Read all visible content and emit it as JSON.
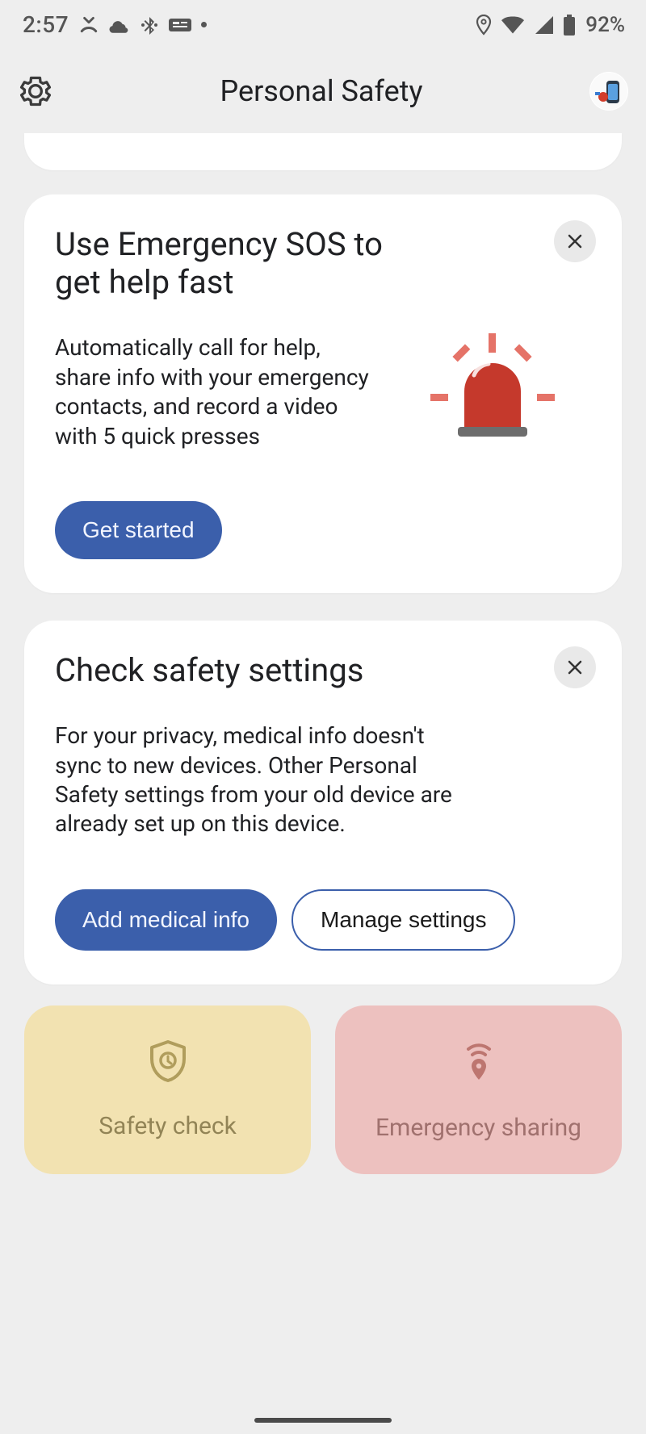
{
  "status": {
    "time": "2:57",
    "battery_text": "92%"
  },
  "header": {
    "title": "Personal Safety"
  },
  "cards": {
    "sos": {
      "title": "Use Emergency SOS to get help fast",
      "body": "Automatically call for help, share info with your emergency contacts, and record a video with 5 quick presses",
      "cta": "Get started"
    },
    "settings": {
      "title": "Check safety settings",
      "body": "For your privacy, medical info doesn't sync to new devices. Other Personal Safety settings from your old device are already set up on this device.",
      "cta_primary": "Add medical info",
      "cta_secondary": "Manage settings"
    }
  },
  "tiles": {
    "safety_check": "Safety check",
    "emergency_sharing": "Emergency sharing"
  }
}
